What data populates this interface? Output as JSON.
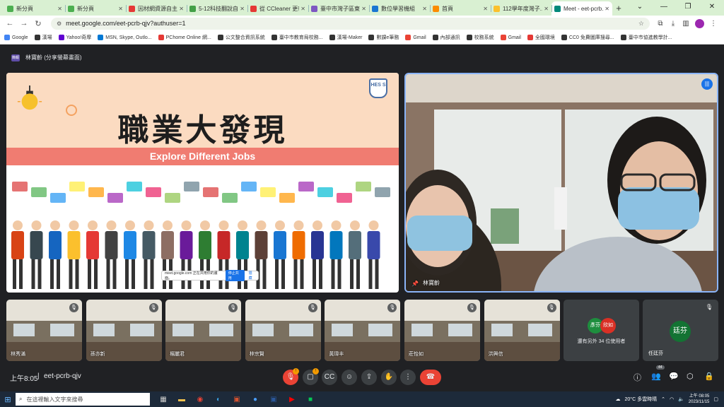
{
  "browser": {
    "tabs": [
      {
        "label": "新分頁",
        "color": "#4caf50"
      },
      {
        "label": "新分頁",
        "color": "#4caf50"
      },
      {
        "label": "因材網資源自主...",
        "color": "#e53935"
      },
      {
        "label": "5-12科技翻說自...",
        "color": "#43a047"
      },
      {
        "label": "從 CCleaner 更新...",
        "color": "#e53935"
      },
      {
        "label": "臺中市灣子區東...",
        "color": "#7e57c2"
      },
      {
        "label": "數位學習機組",
        "color": "#1976d2"
      },
      {
        "label": "首頁",
        "color": "#fb8c00"
      },
      {
        "label": "112學年度灣子...",
        "color": "#fbc02d"
      },
      {
        "label": "Meet - eet-pcrb...",
        "color": "#00897b"
      }
    ],
    "url": "meet.google.com/eet-pcrb-qjv?authuser=1",
    "bookmarks": [
      {
        "label": "Google",
        "color": "#4285f4"
      },
      {
        "label": "漢場",
        "color": "#333"
      },
      {
        "label": "Yahoo!奇摩",
        "color": "#6001d2"
      },
      {
        "label": "MSN, Skype, Outlo...",
        "color": "#0078d4"
      },
      {
        "label": "PChome Online 網...",
        "color": "#e53935"
      },
      {
        "label": "公文整合資訊系統",
        "color": "#333"
      },
      {
        "label": "臺中市教育局校務...",
        "color": "#333"
      },
      {
        "label": "漢場-Maker",
        "color": "#333"
      },
      {
        "label": "數課e筆務",
        "color": "#333"
      },
      {
        "label": "Gmail",
        "color": "#ea4335"
      },
      {
        "label": "內部通訊",
        "color": "#333"
      },
      {
        "label": "校務系統",
        "color": "#333"
      },
      {
        "label": "Gmail",
        "color": "#ea4335"
      },
      {
        "label": "全國環境",
        "color": "#e53935"
      },
      {
        "label": "CC0 免費圖庫搜尋...",
        "color": "#333"
      },
      {
        "label": "臺中市協進教學計...",
        "color": "#333"
      }
    ]
  },
  "meet": {
    "presenter_header": "林寶齡 (分享螢幕畫面)",
    "present_icon_text": "簡報",
    "slide": {
      "title": "職業大發現",
      "subtitle": "Explore Different Jobs",
      "logo_text": "HES S",
      "share_bar_text": "meet.google.com 正在共用你的畫面。",
      "share_stop": "停止共用",
      "share_hide": "隱藏"
    },
    "main_speaker": "林寶齡",
    "tiles": [
      {
        "name": "林秀滿",
        "bg": "#6b7a86"
      },
      {
        "name": "孫亦新",
        "bg": "#5c6a5e"
      },
      {
        "name": "楊麗君",
        "bg": "#7d6b55"
      },
      {
        "name": "林宗賢",
        "bg": "#6a6f78"
      },
      {
        "name": "黃瑋丰",
        "bg": "#6d7780"
      },
      {
        "name": "莊怡如",
        "bg": "#5f6a74"
      },
      {
        "name": "洪興信",
        "bg": "#6f7f73"
      }
    ],
    "others": {
      "avatar1": "彥芬",
      "avatar2": "欣如",
      "text": "還有另外 34 位使用者"
    },
    "pinned": {
      "name": "任廷芬",
      "avatar": "廷芬"
    },
    "bottom": {
      "time": "上午8:05",
      "code": "eet-pcrb-qjv",
      "participant_count": "44"
    }
  },
  "taskbar": {
    "search_placeholder": "在這裡輸入文字來搜尋",
    "weather": "20°C 多雲時晴",
    "time": "上午 08:05",
    "date": "2023/11/15"
  }
}
